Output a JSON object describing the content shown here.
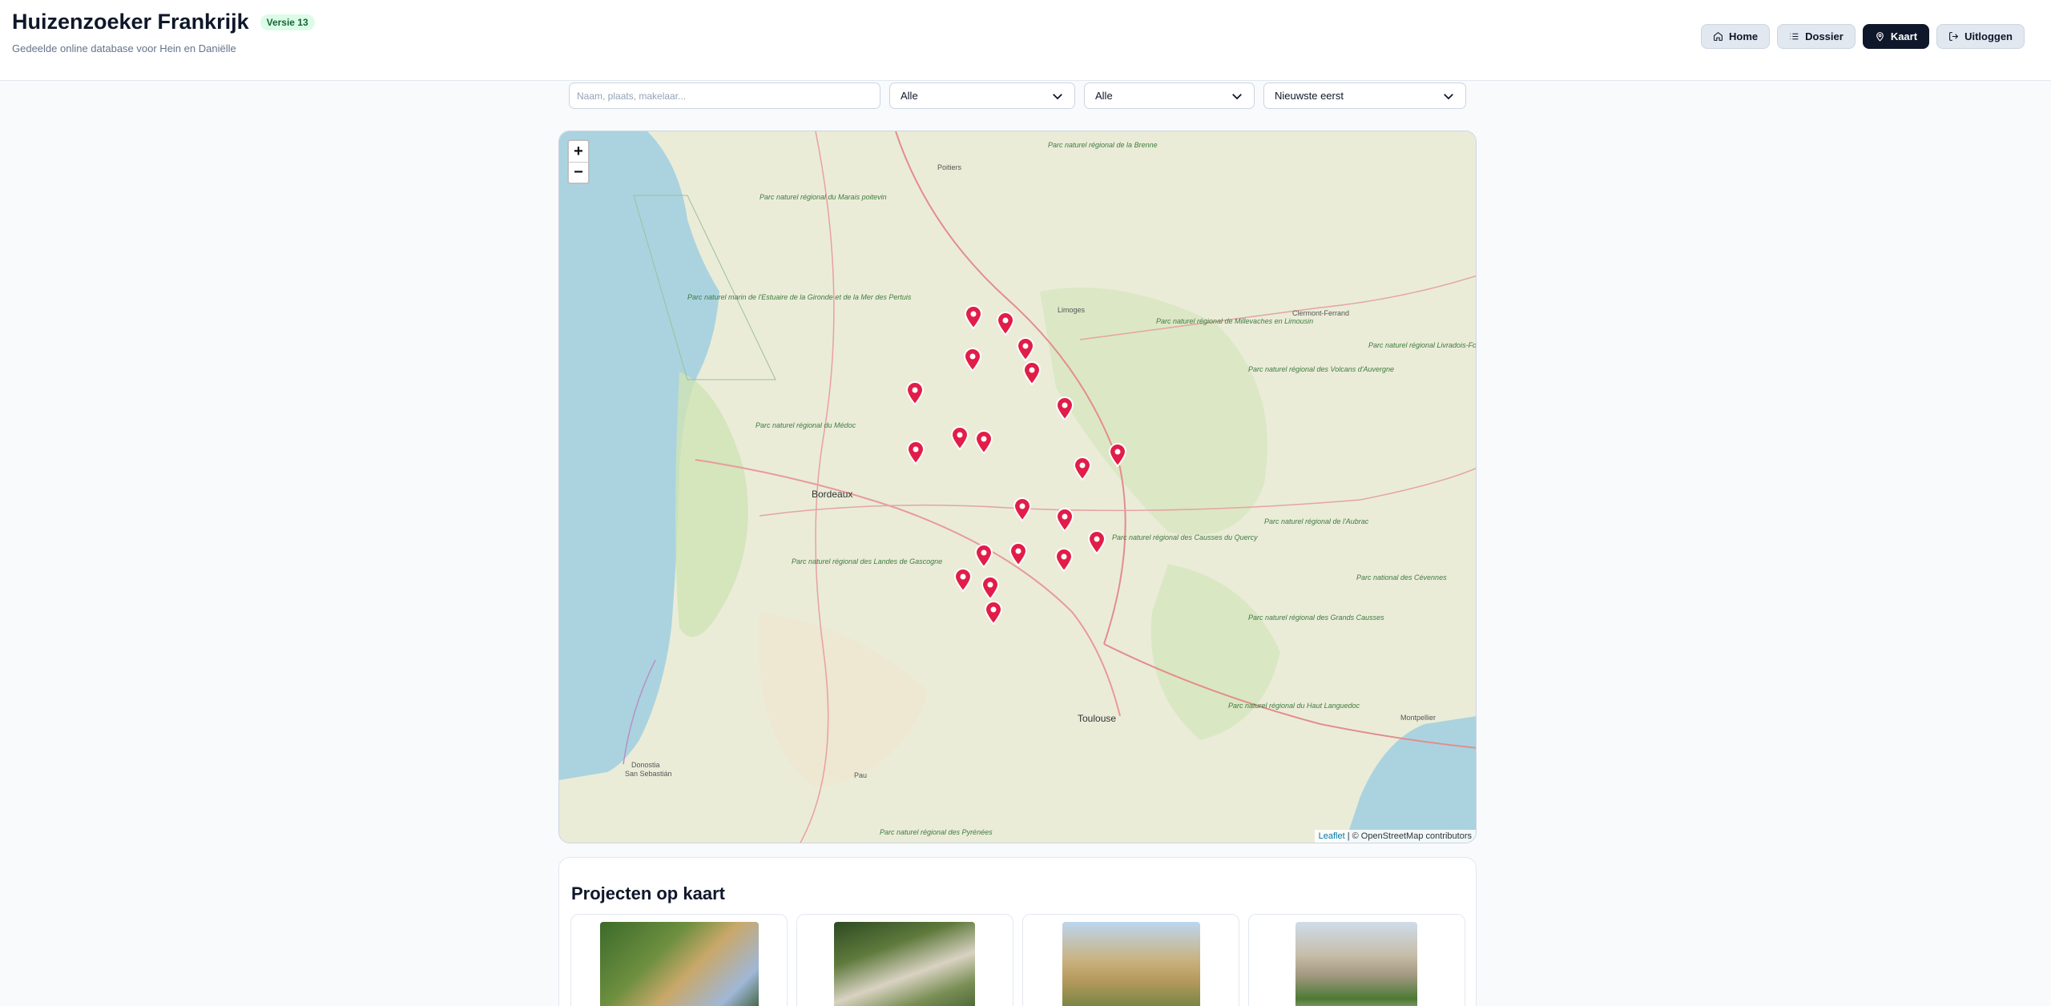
{
  "header": {
    "title": "Huizenzoeker Frankrijk",
    "version": "Versie 13",
    "subtitle": "Gedeelde online database voor Hein en Daniëlle"
  },
  "nav": {
    "home": "Home",
    "dossier": "Dossier",
    "kaart": "Kaart",
    "logout": "Uitloggen"
  },
  "filters": {
    "search_placeholder": "Naam, plaats, makelaar...",
    "select1": "Alle",
    "select2": "Alle",
    "sort": "Nieuwste eerst"
  },
  "map": {
    "zoom_in": "+",
    "zoom_out": "−",
    "attribution_leaflet": "Leaflet",
    "attribution_rest": " | © OpenStreetMap contributors",
    "labels": {
      "bordeaux": "Bordeaux",
      "toulouse": "Toulouse",
      "limoges": "Limoges",
      "poitiers": "Poitiers",
      "clermont": "Clermont-Ferrand",
      "montpellier": "Montpellier",
      "pau": "Pau",
      "donostia": "Donostia",
      "sansebastian": "San Sebastián",
      "p1": "Parc naturel marin de l'Estuaire de la Gironde et de la Mer des Pertuis",
      "p2": "Parc naturel régional du Médoc",
      "p3": "Parc naturel régional des Landes de Gascogne",
      "p4": "Parc naturel régional de Millevaches en Limousin",
      "p5": "Parc naturel régional des Volcans d'Auvergne",
      "p6": "Parc naturel régional des Causses du Quercy",
      "p7": "Parc naturel régional des Grands Causses",
      "p8": "Parc naturel régional du Haut Languedoc",
      "p9": "Parc naturel régional Livradois-Forez",
      "p10": "Parc naturel régional de l'Aubrac",
      "p11": "Parc naturel régional du Marais poitevin",
      "p12": "Parc naturel régional de la Brenne",
      "p13": "Parc national des Cévennes",
      "p14": "Parc naturel régional des Pyrénées"
    }
  },
  "projects": {
    "title": "Projecten op kaart"
  },
  "colors": {
    "marker": "#e11d48",
    "primary": "#0f172a",
    "badge_bg": "#dcfce7"
  }
}
